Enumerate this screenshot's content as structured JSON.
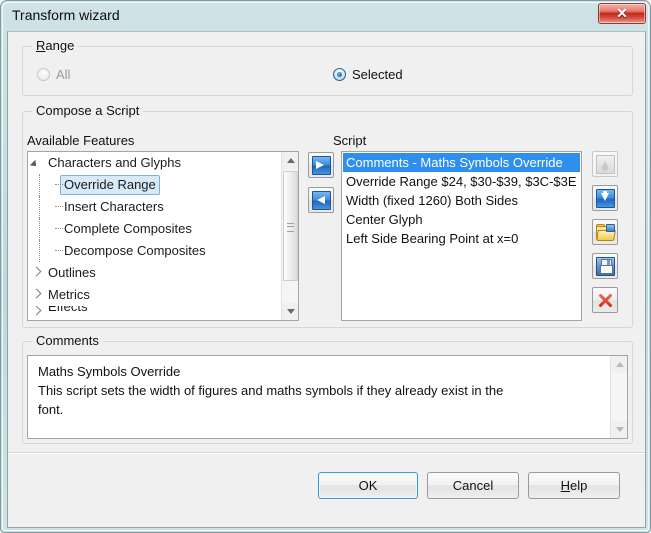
{
  "window": {
    "title": "Transform wizard",
    "close_label": "✕"
  },
  "range_group": {
    "legend_accel": "R",
    "legend_rest": "ange",
    "options": [
      {
        "label": "All",
        "checked": false,
        "disabled": true
      },
      {
        "label": "Selected",
        "checked": true,
        "disabled": false
      }
    ]
  },
  "compose_group": {
    "legend": "Compose a Script",
    "available_caption": "Available Features",
    "script_caption": "Script"
  },
  "available_features": {
    "rows": [
      {
        "label": "Characters and Glyphs",
        "level": 0,
        "twisty": "expanded",
        "selected": false,
        "clipped": false
      },
      {
        "label": "Override Range",
        "level": 1,
        "twisty": "none",
        "selected": true,
        "clipped": false
      },
      {
        "label": "Insert Characters",
        "level": 1,
        "twisty": "none",
        "selected": false,
        "clipped": false
      },
      {
        "label": "Complete Composites",
        "level": 1,
        "twisty": "none",
        "selected": false,
        "clipped": false
      },
      {
        "label": "Decompose Composites",
        "level": 1,
        "twisty": "none",
        "selected": false,
        "clipped": false
      },
      {
        "label": "Outlines",
        "level": 0,
        "twisty": "collapsed",
        "selected": false,
        "clipped": false
      },
      {
        "label": "Metrics",
        "level": 0,
        "twisty": "collapsed",
        "selected": false,
        "clipped": false
      },
      {
        "label": "Effects",
        "level": 0,
        "twisty": "collapsed",
        "selected": false,
        "clipped": true
      }
    ]
  },
  "script_list": {
    "rows": [
      {
        "text": "Comments - Maths Symbols Override",
        "selected": true
      },
      {
        "text": "Override Range $24, $30-$39, $3C-$3E",
        "selected": false
      },
      {
        "text": "Width (fixed 1260) Both Sides",
        "selected": false
      },
      {
        "text": "Center Glyph",
        "selected": false
      },
      {
        "text": "Left Side Bearing Point at x=0",
        "selected": false
      }
    ]
  },
  "transfer_buttons": [
    {
      "name": "add-to-script-button",
      "icon": "arrow-right-icon",
      "disabled": false
    },
    {
      "name": "remove-from-script-button",
      "icon": "arrow-left-icon",
      "disabled": false
    }
  ],
  "script_tools": [
    {
      "name": "move-up-button",
      "icon": "arrow-up-icon",
      "disabled": true
    },
    {
      "name": "move-down-button",
      "icon": "arrow-down-icon",
      "disabled": false
    },
    {
      "name": "open-script-button",
      "icon": "open-folder-icon",
      "disabled": false
    },
    {
      "name": "save-script-button",
      "icon": "save-floppy-icon",
      "disabled": false
    },
    {
      "name": "delete-script-button",
      "icon": "delete-x-icon",
      "disabled": false
    }
  ],
  "comments_group": {
    "legend": "Comments",
    "line1": "Maths Symbols Override",
    "line2": "This script sets the width of figures and maths symbols if they already exist in the",
    "line3": "font."
  },
  "footer": {
    "ok_label": "OK",
    "cancel_label": "Cancel",
    "help_accel": "H",
    "help_rest": "elp"
  },
  "colors": {
    "titlebar": "#c5dfe2",
    "dialog_bg": "#f0f0f0",
    "selection_blue": "#2f8fef",
    "tree_selection": "#d8eaf8",
    "close_red": "#c3291b",
    "focus_blue": "#3c9ad6"
  }
}
